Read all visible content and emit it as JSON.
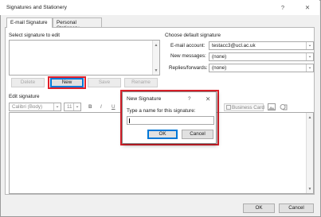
{
  "window": {
    "title": "Signatures and Stationery",
    "help": "?",
    "close": "✕"
  },
  "tabs": [
    "E-mail Signature",
    "Personal Stationery"
  ],
  "left": {
    "select_label": "Select signature to edit",
    "buttons": [
      "Delete",
      "New",
      "Save",
      "Rename"
    ]
  },
  "defaults": {
    "heading": "Choose default signature",
    "email_account_label": "E-mail account:",
    "email_account_value": "testacc3@ucl.ac.uk",
    "new_messages_label": "New messages:",
    "new_messages_value": "(none)",
    "replies_label": "Replies/forwards:",
    "replies_value": "(none)"
  },
  "edit": {
    "heading": "Edit signature",
    "font_value": "Calibri (Body)",
    "size_value": "11",
    "bold": "B",
    "italic": "I",
    "underline": "U",
    "business_card": "Business Card"
  },
  "dialog": {
    "title": "New Signature",
    "help": "?",
    "close": "✕",
    "prompt": "Type a name for this signature:",
    "input_value": "",
    "ok": "OK",
    "cancel": "Cancel"
  },
  "footer": {
    "ok": "OK",
    "cancel": "Cancel"
  }
}
